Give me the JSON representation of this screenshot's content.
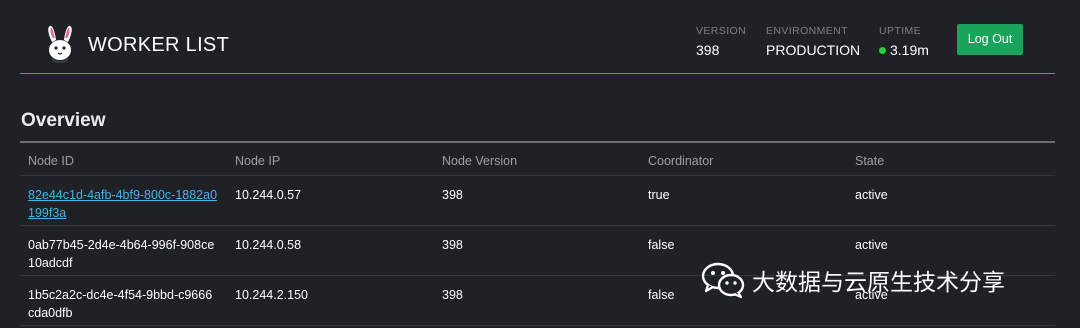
{
  "header": {
    "title": "WORKER LIST",
    "version_label": "VERSION",
    "version_value": "398",
    "environment_label": "ENVIRONMENT",
    "environment_value": "PRODUCTION",
    "uptime_label": "UPTIME",
    "uptime_value": "3.19m",
    "logout_label": "Log Out"
  },
  "overview": {
    "title": "Overview",
    "columns": [
      "Node ID",
      "Node IP",
      "Node Version",
      "Coordinator",
      "State"
    ],
    "rows": [
      {
        "node_id": "82e44c1d-4afb-4bf9-800c-1882a0199f3a",
        "node_ip": "10.244.0.57",
        "node_version": "398",
        "coordinator": "true",
        "state": "active"
      },
      {
        "node_id": "0ab77b45-2d4e-4b64-996f-908ce10adcdf",
        "node_ip": "10.244.0.58",
        "node_version": "398",
        "coordinator": "false",
        "state": "active"
      },
      {
        "node_id": "1b5c2a2c-dc4e-4f54-9bbd-c9666cda0dfb",
        "node_ip": "10.244.2.150",
        "node_version": "398",
        "coordinator": "false",
        "state": "active"
      }
    ]
  },
  "watermark": {
    "text": "大数据与云原生技术分享"
  },
  "colors": {
    "background": "#1f2126",
    "accent_line": "#2aa6b8",
    "logout_button": "#1aa35a",
    "link": "#3fb6ea",
    "uptime_dot": "#2ecc40"
  },
  "icons": {
    "logo": "bunny-logo-icon",
    "uptime": "status-dot-icon",
    "watermark": "wechat-icon"
  }
}
